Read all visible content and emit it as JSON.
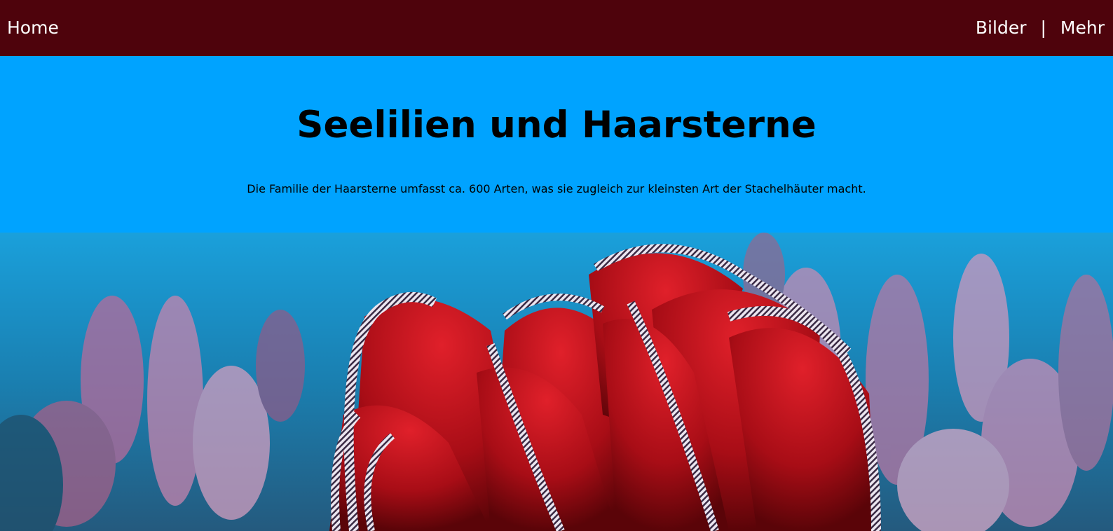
{
  "nav": {
    "home": "Home",
    "images": "Bilder",
    "separator": "|",
    "more": "Mehr"
  },
  "hero": {
    "title": "Seelilien und Haarsterne",
    "subtitle": "Die Familie der Haarsterne umfasst ca. 600 Arten, was sie zugleich zur kleinsten Art der Stachelhäuter macht."
  },
  "colors": {
    "nav_bg": "#4e030c",
    "hero_bg": "#00a3ff",
    "crinoid_red": "#c0101a"
  },
  "photo": {
    "icon": "feather-star-photo"
  }
}
